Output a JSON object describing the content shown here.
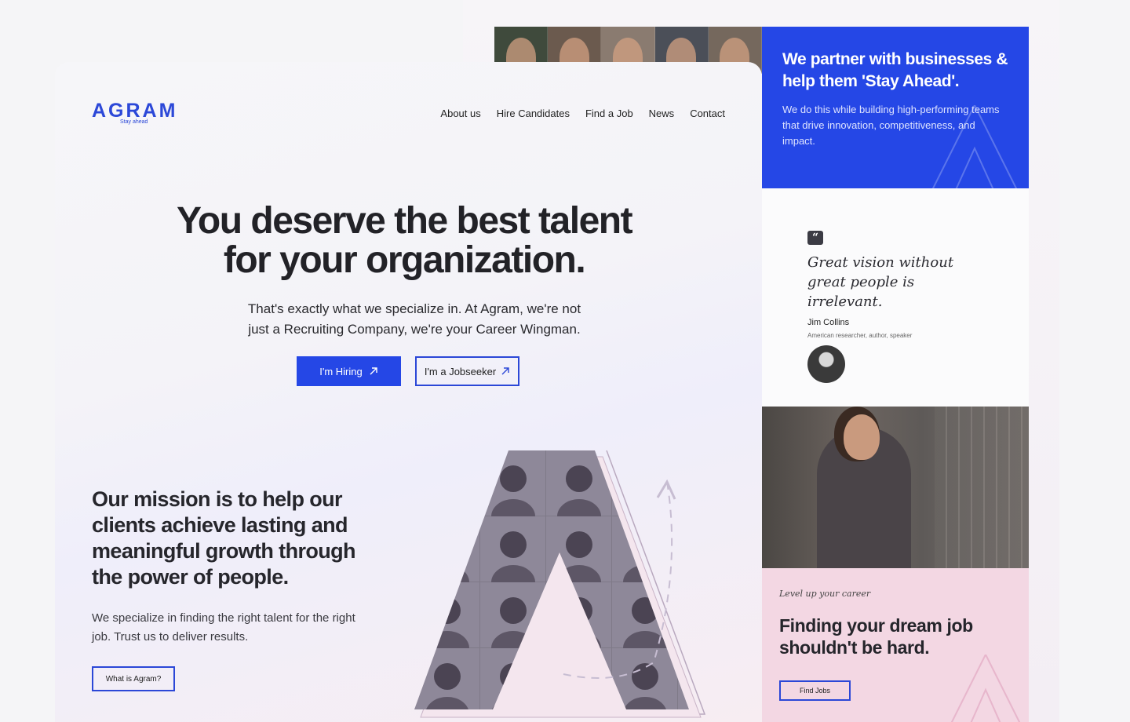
{
  "brand": {
    "name": "AGRAM",
    "tagline": "Stay ahead",
    "accent": "#2547e6",
    "pink": "#f3d7e3"
  },
  "nav": {
    "items": [
      "About us",
      "Hire Candidates",
      "Find a Job",
      "News",
      "Contact"
    ]
  },
  "hero": {
    "title_line1": "You deserve the best talent",
    "title_line2": "for your organization.",
    "subtitle_line1": "That's exactly what we specialize in. At Agram, we're not",
    "subtitle_line2": "just a Recruiting Company, we're your Career Wingman.",
    "primary_button": "I'm Hiring",
    "secondary_button": "I'm a Jobseeker",
    "button_icon": "arrow-up-right-icon"
  },
  "mission": {
    "heading": "Our mission is to help our clients achieve lasting and meaningful growth through the power of people.",
    "body": "We specialize in finding the right talent for the right job. Trust us to deliver results.",
    "button": "What is Agram?"
  },
  "partner": {
    "heading": "We partner with businesses & help them 'Stay Ahead'.",
    "body": "We do this while building high-performing teams that drive innovation, competitiveness, and impact."
  },
  "quote": {
    "icon": "quote-icon",
    "text": "Great vision without great people is irrelevant.",
    "author": "Jim Collins",
    "role": "American researcher, author, speaker"
  },
  "career": {
    "eyebrow": "Level up your career",
    "heading": "Finding your dream job shouldn't be hard.",
    "button": "Find Jobs"
  }
}
